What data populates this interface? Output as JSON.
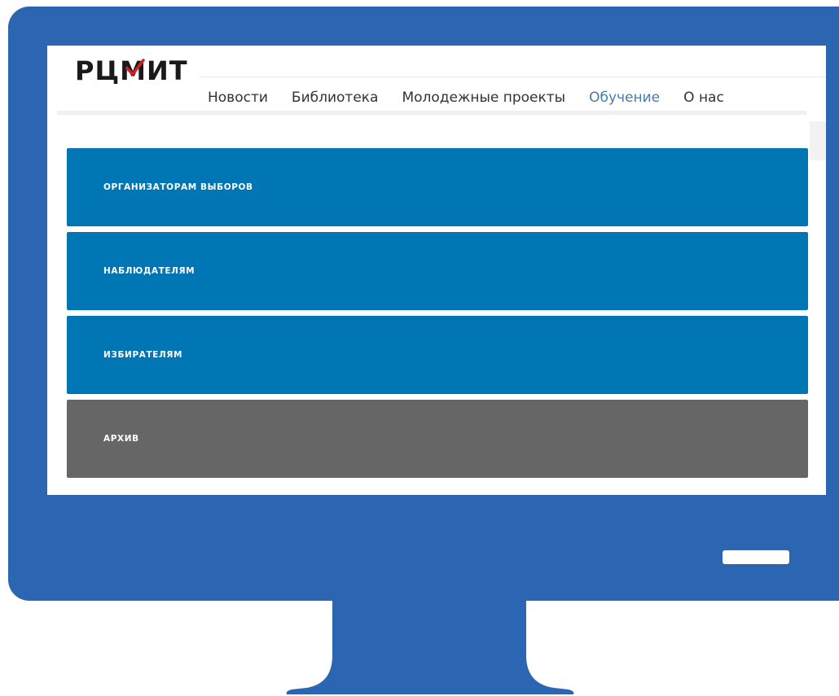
{
  "header": {
    "logo_text": "РЦМИТ"
  },
  "nav": {
    "items": [
      {
        "label": "Новости"
      },
      {
        "label": "Библиотека"
      },
      {
        "label": "Молодежные проекты"
      },
      {
        "label": "Обучение",
        "active": true
      },
      {
        "label": "О нас"
      }
    ]
  },
  "panels": [
    {
      "label": "ОРГАНИЗАТОРАМ ВЫБОРОВ",
      "color": "#0077b4"
    },
    {
      "label": "НАБЛЮДАТЕЛЯМ",
      "color": "#0077b4"
    },
    {
      "label": "ИЗБИРАТЕЛЯМ",
      "color": "#0077b4"
    },
    {
      "label": "АРХИВ",
      "color": "#666666"
    }
  ],
  "colors": {
    "monitor_frame": "#2c66b3",
    "accent_blue": "#0077b4",
    "archive_gray": "#666666",
    "nav_active": "#4a7aa6",
    "logo_check": "#d0202a"
  }
}
